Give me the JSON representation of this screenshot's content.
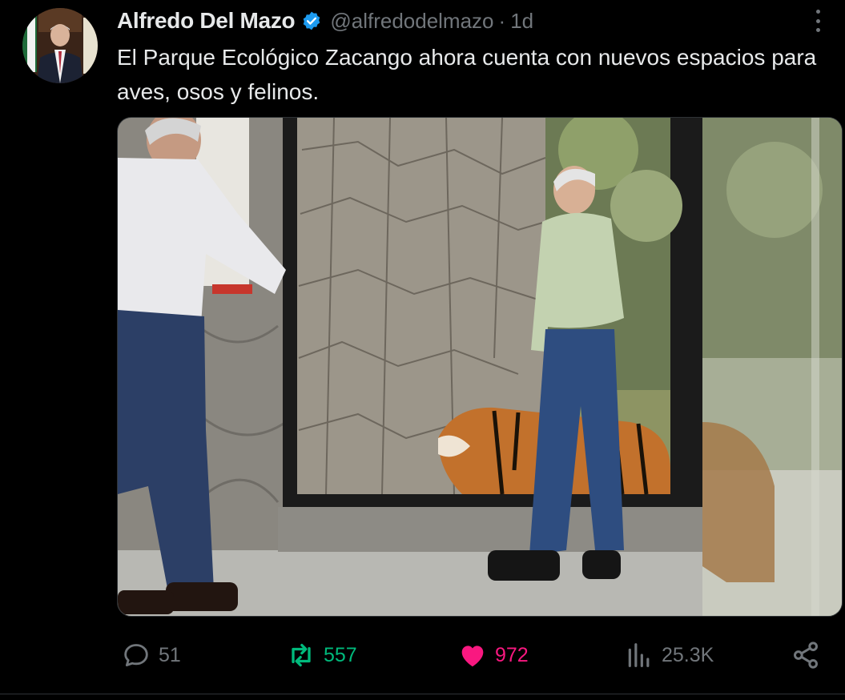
{
  "author": {
    "name": "Alfredo Del Mazo",
    "handle": "@alfredodelmazo",
    "separator": "·",
    "time": "1d",
    "verified_icon": "verified-badge-icon",
    "verified_color": "#1d9bf0"
  },
  "tweet": {
    "text": "El Parque Ecológico Zacango ahora cuenta con nuevos espacios para aves, osos y felinos."
  },
  "actions": {
    "reply": {
      "icon": "reply-bubble-icon",
      "count": "51"
    },
    "retweet": {
      "icon": "retweet-icon",
      "count": "557",
      "color": "#00ba7c"
    },
    "like": {
      "icon": "heart-icon",
      "count": "972",
      "color": "#f91880"
    },
    "views": {
      "icon": "views-bar-chart-icon",
      "count": "25.3K"
    },
    "share": {
      "icon": "share-icon"
    }
  },
  "menu": {
    "icon": "more-options-icon"
  }
}
